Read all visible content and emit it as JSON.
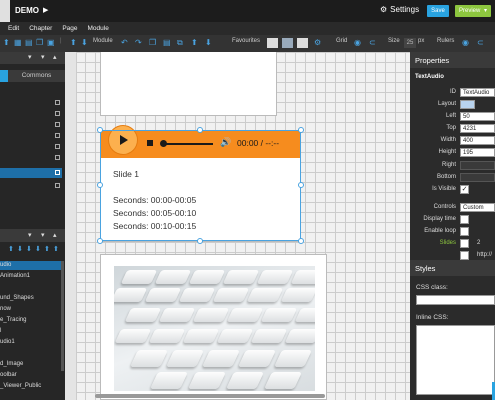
{
  "topbar": {
    "title": "DEMO",
    "settings_label": "Settings",
    "save_label": "Save",
    "preview_label": "Preview",
    "preview_caret": "▾"
  },
  "menu": [
    "Edit",
    "Chapter",
    "Page",
    "Module"
  ],
  "toolbar": {
    "module_label": "Module",
    "favourites_label": "Favourites",
    "grid_label": "Grid",
    "size_label": "Size",
    "size_value": "25",
    "size_unit": "px",
    "rulers_label": "Rulers"
  },
  "left_panel": {
    "tab_commons": "Commons",
    "pages": [
      "udio",
      "Animation1",
      "",
      "und_Shapes",
      "now",
      "e_Tracing",
      "l",
      "udio1",
      "",
      "d_Image",
      "oolbar",
      "_Viewer_Public"
    ]
  },
  "audio": {
    "time_label": "00:00 / --:--"
  },
  "slide": {
    "title": "Slide 1",
    "lines": [
      "Seconds: 00:00-00:05",
      "Seconds: 00:05-00:10",
      "Seconds: 00:10-00:15"
    ]
  },
  "properties": {
    "header": "Properties",
    "component": "TextAudio",
    "fields": {
      "id_label": "ID",
      "id_value": "TextAudio",
      "layout_label": "Layout",
      "left_label": "Left",
      "left_value": "50",
      "top_label": "Top",
      "top_value": "4231",
      "width_label": "Width",
      "width_value": "400",
      "height_label": "Height",
      "height_value": "195",
      "right_label": "Right",
      "bottom_label": "Bottom",
      "visible_label": "Is Visible",
      "visible_checked": "✓",
      "controls_label": "Controls",
      "controls_value": "Custom",
      "display_time_label": "Display time",
      "enable_loop_label": "Enable loop",
      "slides_label": "Slides",
      "slides_value": "2",
      "extra_value": "http://"
    }
  },
  "styles": {
    "header": "Styles",
    "css_class_label": "CSS class:",
    "inline_css_label": "Inline CSS:"
  },
  "colors": {
    "accent": "#29a3e0",
    "preview": "#8dc63f",
    "audio_bar": "#f68c1e",
    "selection": "#1e6fa8"
  }
}
